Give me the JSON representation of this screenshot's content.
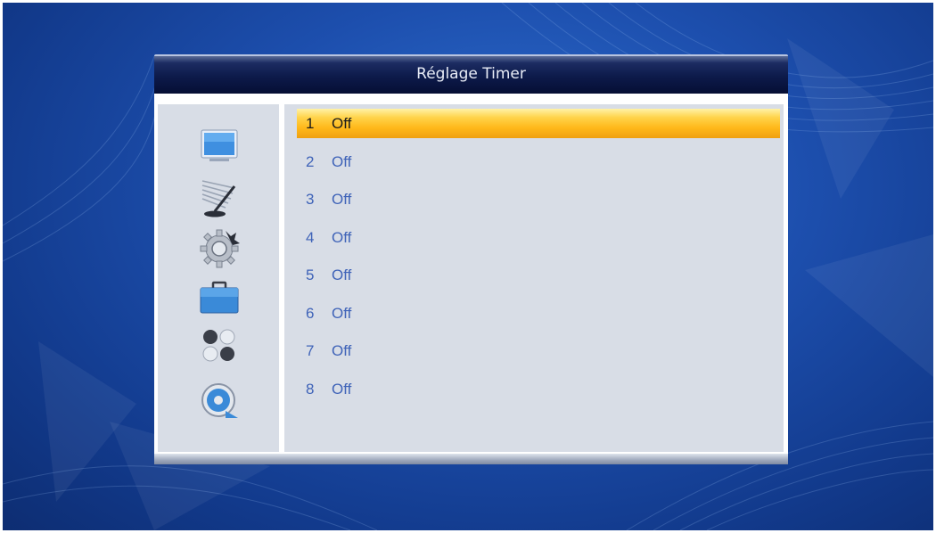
{
  "window": {
    "title": "Réglage Timer"
  },
  "sidebar": {
    "items": [
      {
        "icon": "tv-screen-icon"
      },
      {
        "icon": "satellite-dish-icon"
      },
      {
        "icon": "gear-settings-icon"
      },
      {
        "icon": "toolbox-icon"
      },
      {
        "icon": "games-balls-icon"
      },
      {
        "icon": "media-player-icon"
      }
    ]
  },
  "timers": [
    {
      "number": "1",
      "status": "Off",
      "selected": true
    },
    {
      "number": "2",
      "status": "Off",
      "selected": false
    },
    {
      "number": "3",
      "status": "Off",
      "selected": false
    },
    {
      "number": "4",
      "status": "Off",
      "selected": false
    },
    {
      "number": "5",
      "status": "Off",
      "selected": false
    },
    {
      "number": "6",
      "status": "Off",
      "selected": false
    },
    {
      "number": "7",
      "status": "Off",
      "selected": false
    },
    {
      "number": "8",
      "status": "Off",
      "selected": false
    }
  ],
  "colors": {
    "highlight": "#ffc020",
    "item_text": "#3f63b8",
    "panel": "#d8dde6",
    "title_bar": "#0d1a4a",
    "background": "#1d4fae"
  }
}
